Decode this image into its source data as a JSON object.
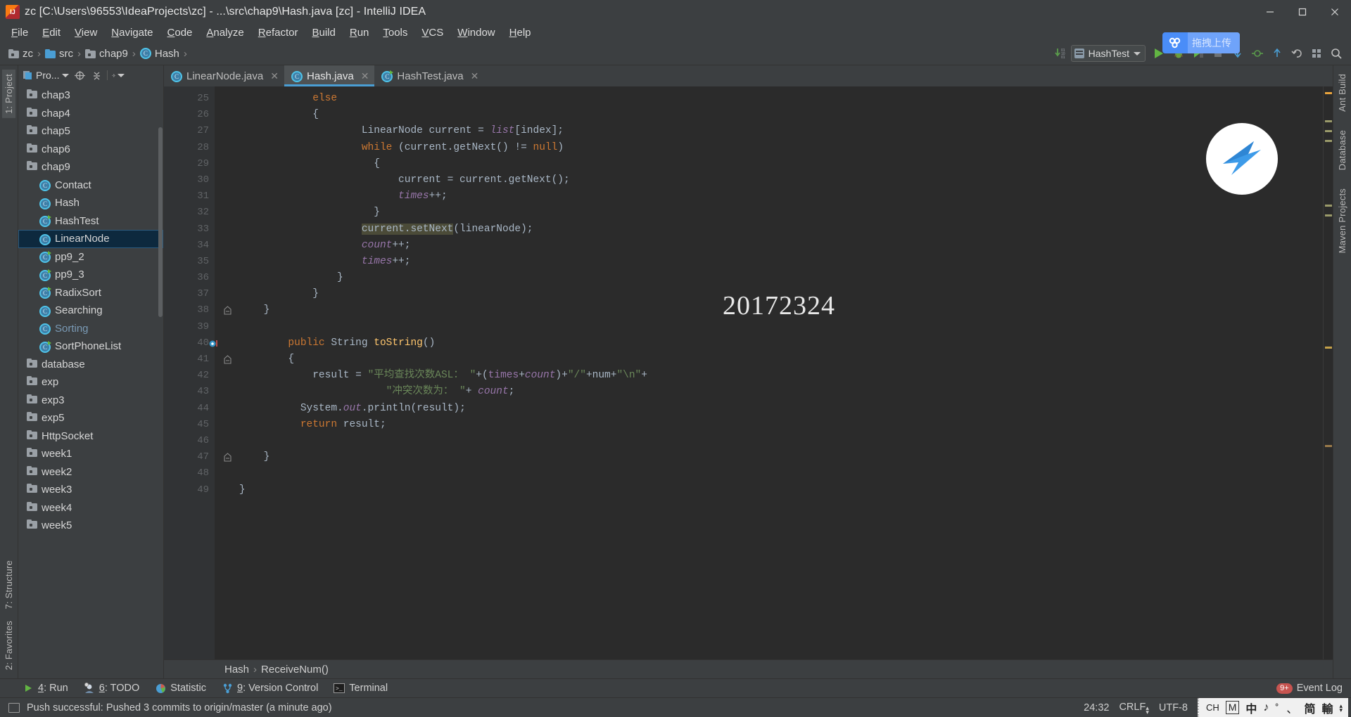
{
  "window": {
    "title": "zc [C:\\Users\\96553\\IdeaProjects\\zc] - ...\\src\\chap9\\Hash.java [zc] - IntelliJ IDEA",
    "logo_name": "intellij-idea-logo",
    "minimize": "—",
    "maximize": "❐",
    "close": "✕"
  },
  "menubar": {
    "items": [
      "File",
      "Edit",
      "View",
      "Navigate",
      "Code",
      "Analyze",
      "Refactor",
      "Build",
      "Run",
      "Tools",
      "VCS",
      "Window",
      "Help"
    ]
  },
  "navbar": {
    "breadcrumbs": [
      {
        "label": "zc",
        "icon": "project-folder-icon"
      },
      {
        "label": "src",
        "icon": "source-folder-icon"
      },
      {
        "label": "chap9",
        "icon": "folder-icon"
      },
      {
        "label": "Hash",
        "icon": "class-icon"
      }
    ],
    "separator": "›",
    "run_config": "HashTest",
    "buttons": [
      {
        "name": "update-project-button",
        "glyph": "↓"
      },
      {
        "name": "run-button",
        "glyph": "▶"
      },
      {
        "name": "debug-button",
        "glyph": "🐞"
      },
      {
        "name": "run-with-coverage-button",
        "glyph": "▶"
      },
      {
        "name": "stop-button",
        "glyph": "■"
      },
      {
        "name": "git-update-button",
        "glyph": "⤓"
      },
      {
        "name": "git-commit-button",
        "glyph": "✔"
      },
      {
        "name": "git-push-button",
        "glyph": "⤒"
      },
      {
        "name": "undo-button",
        "glyph": "↶"
      },
      {
        "name": "settings-button",
        "glyph": "☰"
      },
      {
        "name": "search-everywhere-button",
        "glyph": "🔍"
      }
    ],
    "upload_badge": {
      "text": "拖拽上传",
      "icon": "baidu-netdisk-icon",
      "color": "#4a8df8"
    }
  },
  "left_rail": {
    "top": [
      {
        "label": "1: Project",
        "active": true
      }
    ],
    "bottom": [
      {
        "label": "7: Structure"
      },
      {
        "label": "2: Favorites"
      }
    ]
  },
  "right_rail": {
    "items": [
      {
        "label": "Ant Build"
      },
      {
        "label": "Database"
      },
      {
        "label": "Maven Projects"
      }
    ]
  },
  "project_panel": {
    "title": "Pro...",
    "tools": [
      {
        "name": "scroll-from-source-icon",
        "glyph": "⊕"
      },
      {
        "name": "collapse-all-icon",
        "glyph": "⤓"
      },
      {
        "name": "settings-gear-icon",
        "glyph": "⚙"
      }
    ],
    "tree": [
      {
        "label": "chap3",
        "type": "folder",
        "depth": 1
      },
      {
        "label": "chap4",
        "type": "folder",
        "depth": 1
      },
      {
        "label": "chap5",
        "type": "folder",
        "depth": 1
      },
      {
        "label": "chap6",
        "type": "folder",
        "depth": 1
      },
      {
        "label": "chap9",
        "type": "folder",
        "depth": 1
      },
      {
        "label": "Contact",
        "type": "class",
        "depth": 2
      },
      {
        "label": "Hash",
        "type": "class",
        "depth": 2
      },
      {
        "label": "HashTest",
        "type": "class-runnable",
        "depth": 2
      },
      {
        "label": "LinearNode",
        "type": "class",
        "depth": 2,
        "selected": true
      },
      {
        "label": "pp9_2",
        "type": "class-runnable",
        "depth": 2
      },
      {
        "label": "pp9_3",
        "type": "class-runnable",
        "depth": 2
      },
      {
        "label": "RadixSort",
        "type": "class-runnable",
        "depth": 2
      },
      {
        "label": "Searching",
        "type": "class",
        "depth": 2
      },
      {
        "label": "Sorting",
        "type": "class",
        "depth": 2,
        "muted": true
      },
      {
        "label": "SortPhoneList",
        "type": "class-runnable",
        "depth": 2
      },
      {
        "label": "database",
        "type": "folder",
        "depth": 1
      },
      {
        "label": "exp",
        "type": "folder",
        "depth": 1
      },
      {
        "label": "exp3",
        "type": "folder",
        "depth": 1
      },
      {
        "label": "exp5",
        "type": "folder",
        "depth": 1
      },
      {
        "label": "HttpSocket",
        "type": "folder",
        "depth": 1
      },
      {
        "label": "week1",
        "type": "folder",
        "depth": 1
      },
      {
        "label": "week2",
        "type": "folder",
        "depth": 1
      },
      {
        "label": "week3",
        "type": "folder",
        "depth": 1
      },
      {
        "label": "week4",
        "type": "folder",
        "depth": 1
      },
      {
        "label": "week5",
        "type": "folder",
        "depth": 1
      }
    ]
  },
  "editor": {
    "tabs": [
      {
        "label": "LinearNode.java",
        "active": false,
        "icon": "class-icon",
        "close": "✕"
      },
      {
        "label": "Hash.java",
        "active": true,
        "icon": "class-icon",
        "close": "✕"
      },
      {
        "label": "HashTest.java",
        "active": false,
        "icon": "class-runnable-icon",
        "close": "✕"
      }
    ],
    "first_line_number": 25,
    "lines": [
      {
        "n": 25,
        "indent": 8,
        "tokens": [
          {
            "t": "else",
            "c": "k"
          }
        ]
      },
      {
        "n": 26,
        "indent": 8,
        "tokens": [
          {
            "t": "{",
            "c": "id"
          }
        ]
      },
      {
        "n": 27,
        "indent": 12,
        "tokens": [
          {
            "t": "LinearNode current = ",
            "c": "id"
          },
          {
            "t": "list",
            "c": "f"
          },
          {
            "t": "[index];",
            "c": "id"
          }
        ]
      },
      {
        "n": 28,
        "indent": 12,
        "tokens": [
          {
            "t": "while",
            "c": "k"
          },
          {
            "t": " (current.getNext() != ",
            "c": "id"
          },
          {
            "t": "null",
            "c": "k"
          },
          {
            "t": ")",
            "c": "id"
          }
        ]
      },
      {
        "n": 29,
        "indent": 13,
        "tokens": [
          {
            "t": "{",
            "c": "id"
          }
        ]
      },
      {
        "n": 30,
        "indent": 15,
        "tokens": [
          {
            "t": "current = current.getNext();",
            "c": "id"
          }
        ]
      },
      {
        "n": 31,
        "indent": 15,
        "tokens": [
          {
            "t": "times",
            "c": "f"
          },
          {
            "t": "++;",
            "c": "id"
          }
        ]
      },
      {
        "n": 32,
        "indent": 13,
        "tokens": [
          {
            "t": "}",
            "c": "id"
          }
        ]
      },
      {
        "n": 33,
        "indent": 12,
        "tokens": [
          {
            "t": "current.setNext",
            "c": "hl"
          },
          {
            "t": "(linearNode);",
            "c": "id"
          }
        ]
      },
      {
        "n": 34,
        "indent": 12,
        "tokens": [
          {
            "t": "count",
            "c": "f"
          },
          {
            "t": "++;",
            "c": "id"
          }
        ]
      },
      {
        "n": 35,
        "indent": 12,
        "tokens": [
          {
            "t": "times",
            "c": "f"
          },
          {
            "t": "++;",
            "c": "id"
          }
        ]
      },
      {
        "n": 36,
        "indent": 10,
        "tokens": [
          {
            "t": "}",
            "c": "id"
          }
        ]
      },
      {
        "n": 37,
        "indent": 8,
        "tokens": [
          {
            "t": "}",
            "c": "id"
          }
        ]
      },
      {
        "n": 38,
        "indent": 4,
        "tokens": [
          {
            "t": "}",
            "c": "id"
          }
        ],
        "fold": true
      },
      {
        "n": 39,
        "indent": 0,
        "tokens": []
      },
      {
        "n": 40,
        "indent": 6,
        "tokens": [
          {
            "t": "public",
            "c": "k"
          },
          {
            "t": " String ",
            "c": "id"
          },
          {
            "t": "toString",
            "c": "m"
          },
          {
            "t": "()",
            "c": "id"
          }
        ],
        "gutter_icon": "override-method-icon"
      },
      {
        "n": 41,
        "indent": 6,
        "tokens": [
          {
            "t": "{",
            "c": "id"
          }
        ],
        "fold": true
      },
      {
        "n": 42,
        "indent": 8,
        "tokens": [
          {
            "t": "result = ",
            "c": "id"
          },
          {
            "t": "\"平均查找次数ASL： \"",
            "c": "s"
          },
          {
            "t": "+(",
            "c": "id"
          },
          {
            "t": "times",
            "c": "fi"
          },
          {
            "t": "+",
            "c": "id"
          },
          {
            "t": "count",
            "c": "f"
          },
          {
            "t": ")+",
            "c": "id"
          },
          {
            "t": "\"/\"",
            "c": "s"
          },
          {
            "t": "+num+",
            "c": "id"
          },
          {
            "t": "\"\\n\"",
            "c": "s"
          },
          {
            "t": "+",
            "c": "id"
          }
        ]
      },
      {
        "n": 43,
        "indent": 14,
        "tokens": [
          {
            "t": "\"冲突次数为： \"",
            "c": "s"
          },
          {
            "t": "+ ",
            "c": "id"
          },
          {
            "t": "count",
            "c": "f"
          },
          {
            "t": ";",
            "c": "id"
          }
        ]
      },
      {
        "n": 44,
        "indent": 7,
        "tokens": [
          {
            "t": "System.",
            "c": "id"
          },
          {
            "t": "out",
            "c": "f"
          },
          {
            "t": ".println(result);",
            "c": "id"
          }
        ]
      },
      {
        "n": 45,
        "indent": 7,
        "tokens": [
          {
            "t": "return",
            "c": "k"
          },
          {
            "t": " result;",
            "c": "id"
          }
        ]
      },
      {
        "n": 46,
        "indent": 0,
        "tokens": []
      },
      {
        "n": 47,
        "indent": 4,
        "tokens": [
          {
            "t": "}",
            "c": "id"
          }
        ],
        "fold": true
      },
      {
        "n": 48,
        "indent": 0,
        "tokens": []
      },
      {
        "n": 49,
        "indent": 2,
        "tokens": [
          {
            "t": "}",
            "c": "id"
          }
        ]
      }
    ],
    "watermark_text": "20172324",
    "breadcrumb": [
      {
        "label": "Hash"
      },
      {
        "label": "ReceiveNum()"
      }
    ],
    "breadcrumb_sep": "›"
  },
  "bottom_toolwindows": [
    {
      "label": "4: Run",
      "mnemonic": "4",
      "icon": "run-icon"
    },
    {
      "label": "6: TODO",
      "mnemonic": "6",
      "icon": "todo-icon"
    },
    {
      "label": "Statistic",
      "mnemonic": "",
      "icon": "statistic-icon"
    },
    {
      "label": "9: Version Control",
      "mnemonic": "9",
      "icon": "version-control-icon"
    },
    {
      "label": "Terminal",
      "mnemonic": "",
      "icon": "terminal-icon"
    }
  ],
  "event_log": {
    "label": "Event Log",
    "badge": "9+"
  },
  "statusbar": {
    "message": "Push successful: Pushed 3 commits to origin/master (a minute ago)",
    "message_icon": "notification-icon",
    "caret_position": "24:32",
    "line_separator": "CRLF",
    "encoding": "UTF-8",
    "ime": [
      "CH",
      "M",
      "中",
      "♪",
      "゜、",
      "简",
      "輸"
    ]
  },
  "colors": {
    "background": "#3c3f41",
    "editor_background": "#2b2b2b",
    "accent": "#4a9ed4",
    "selection": "#0d293e",
    "keyword": "#cc7832",
    "string": "#6a8759",
    "field": "#9876aa",
    "method": "#ffc66d",
    "highlight": "#4b4b38",
    "upload_badge": "#4a8df8"
  }
}
